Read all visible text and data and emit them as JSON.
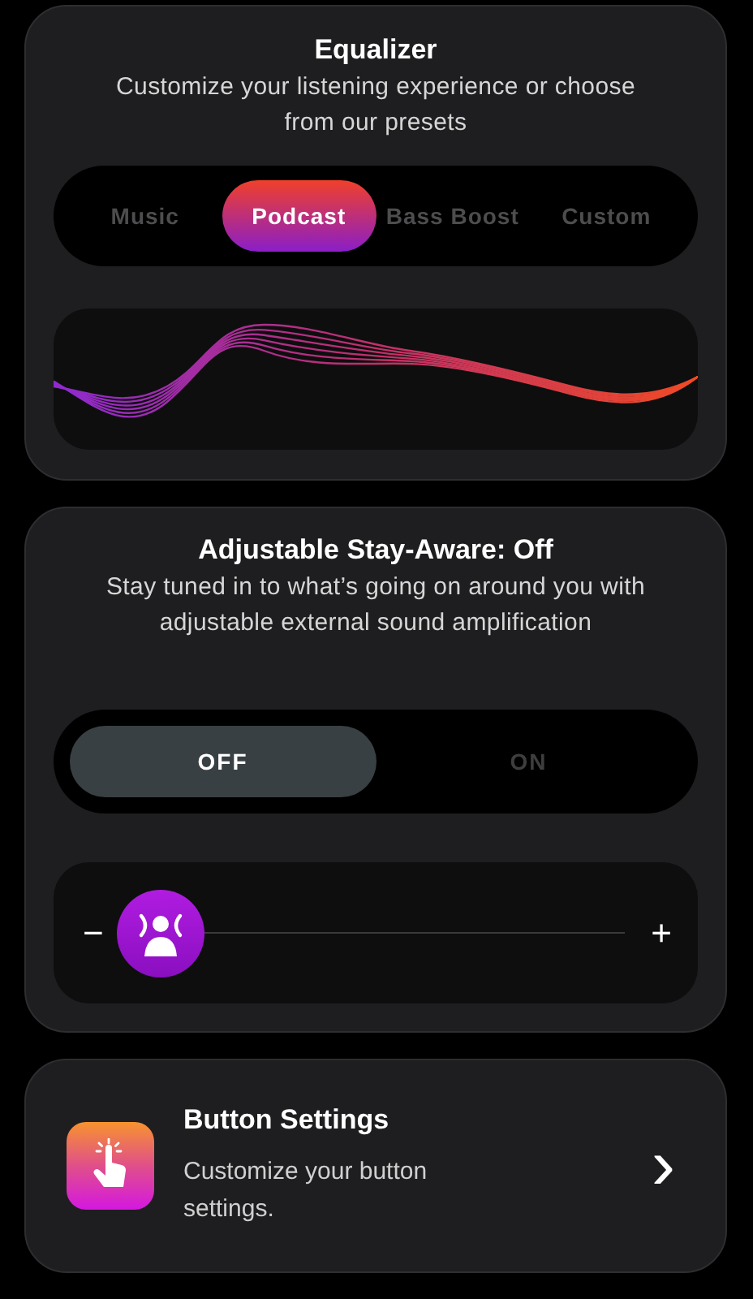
{
  "equalizer": {
    "title": "Equalizer",
    "subtitle": "Customize your listening experience or choose from our presets",
    "presets": [
      {
        "label": "Music",
        "selected": false
      },
      {
        "label": "Podcast",
        "selected": true
      },
      {
        "label": "Bass Boost",
        "selected": false
      },
      {
        "label": "Custom",
        "selected": false
      }
    ]
  },
  "stay_aware": {
    "title": "Adjustable Stay-Aware: Off",
    "subtitle": "Stay tuned in to what’s going on around you with adjustable external sound amplification",
    "modes": [
      {
        "label": "OFF",
        "selected": true
      },
      {
        "label": "ON",
        "selected": false
      }
    ],
    "slider": {
      "minus": "−",
      "plus": "+",
      "level": 0
    }
  },
  "button_settings": {
    "title": "Button Settings",
    "description": "Customize your button settings.",
    "chevron": "›"
  }
}
